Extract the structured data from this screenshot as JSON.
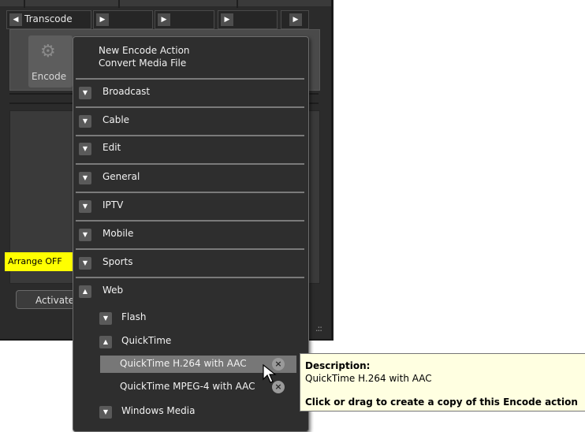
{
  "tabs": {
    "first_label": "Transcode"
  },
  "tile": {
    "label": "Encode",
    "icon": "gears-icon"
  },
  "badge": {
    "label": "Arrange OFF"
  },
  "activate": {
    "label": "Activate"
  },
  "menu": {
    "new_action": "New Encode Action",
    "convert": "Convert Media File",
    "categories": [
      "Broadcast",
      "Cable",
      "Edit",
      "General",
      "IPTV",
      "Mobile",
      "Sports",
      "Web"
    ],
    "web_children": [
      "Flash",
      "QuickTime"
    ],
    "quicktime_items": [
      "QuickTime H.264 with AAC",
      "QuickTime MPEG-4 with AAC"
    ],
    "windows_media": "Windows Media"
  },
  "tooltip": {
    "title": "Description:",
    "text": "QuickTime H.264 with AAC",
    "hint": "Click or drag to create a copy of this Encode action"
  },
  "colors": {
    "badge": "#ffff00",
    "tooltip_bg": "#ffffe1",
    "highlight": "#777777"
  }
}
